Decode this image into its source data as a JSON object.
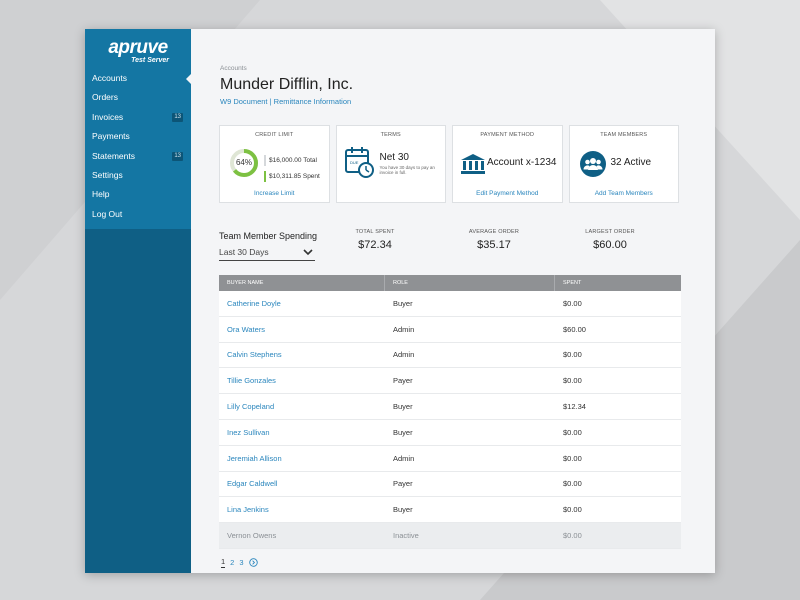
{
  "brand": {
    "name": "apruve",
    "subtitle": "Test Server"
  },
  "sidebar": {
    "items": [
      {
        "label": "Accounts",
        "active": true
      },
      {
        "label": "Orders"
      },
      {
        "label": "Invoices",
        "badge": "13"
      },
      {
        "label": "Payments"
      },
      {
        "label": "Statements",
        "badge": "13"
      },
      {
        "label": "Settings"
      },
      {
        "label": "Help"
      },
      {
        "label": "Log Out"
      }
    ]
  },
  "header": {
    "breadcrumb": "Accounts",
    "title": "Munder Difflin, Inc.",
    "link_w9": "W9 Document",
    "link_sep": " | ",
    "link_remit": "Remittance Information"
  },
  "cards": {
    "credit": {
      "title": "CREDIT LIMIT",
      "percent_label": "64%",
      "used_fraction": 0.64,
      "total": "$16,000.00 Total",
      "spent": "$10,311.85 Spent",
      "link": "Increase Limit"
    },
    "terms": {
      "title": "TERMS",
      "value": "Net 30",
      "desc": "You have 30 days to pay an invoice in full.",
      "icon_text": "DUE"
    },
    "payment": {
      "title": "PAYMENT METHOD",
      "value": "Account x-1234",
      "link": "Edit Payment Method"
    },
    "team": {
      "title": "TEAM MEMBERS",
      "value": "32 Active",
      "link": "Add Team Members"
    }
  },
  "spending": {
    "title": "Team Member Spending",
    "period": "Last 30 Days",
    "stats": [
      {
        "label": "TOTAL SPENT",
        "value": "$72.34"
      },
      {
        "label": "AVERAGE ORDER",
        "value": "$35.17"
      },
      {
        "label": "LARGEST ORDER",
        "value": "$60.00"
      }
    ]
  },
  "table": {
    "headers": [
      "BUYER NAME",
      "ROLE",
      "SPENT"
    ],
    "rows": [
      [
        "Catherine Doyle",
        "Buyer",
        "$0.00"
      ],
      [
        "Ora Waters",
        "Admin",
        "$60.00"
      ],
      [
        "Calvin Stephens",
        "Admin",
        "$0.00"
      ],
      [
        "Tillie Gonzales",
        "Payer",
        "$0.00"
      ],
      [
        "Lilly Copeland",
        "Buyer",
        "$12.34"
      ],
      [
        "Inez Sullivan",
        "Buyer",
        "$0.00"
      ],
      [
        "Jeremiah Allison",
        "Admin",
        "$0.00"
      ],
      [
        "Edgar Caldwell",
        "Payer",
        "$0.00"
      ],
      [
        "Lina Jenkins",
        "Buyer",
        "$0.00"
      ],
      [
        "Vernon Owens",
        "Inactive",
        "$0.00"
      ]
    ]
  },
  "pager": {
    "pages": [
      "1",
      "2",
      "3"
    ],
    "current": "1"
  },
  "colors": {
    "sidebar": "#0f5f85",
    "sidebar_top": "#1476a3",
    "link": "#2a86bd",
    "green": "#7dc142",
    "table_header": "#8f9194"
  }
}
